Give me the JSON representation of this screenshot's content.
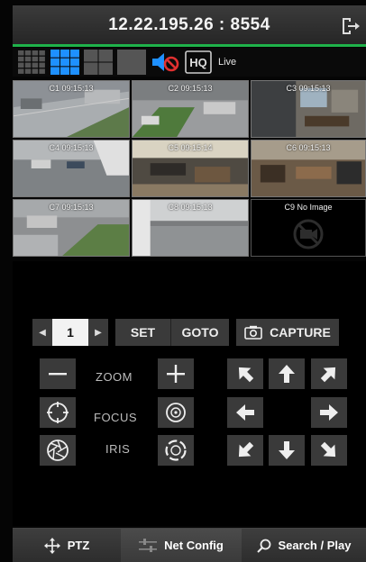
{
  "header": {
    "title": "12.22.195.26 : 8554",
    "logout_icon": "logout-icon"
  },
  "toolbar": {
    "layouts": [
      "layout-16-icon",
      "layout-9-icon",
      "layout-4-icon",
      "layout-1-icon"
    ],
    "active_layout": "layout-9-icon",
    "audio_icon": "audio-muted-icon",
    "hq_label": "HQ",
    "live_label": "Live"
  },
  "cameras": [
    {
      "label": "C1 09:15:13"
    },
    {
      "label": "C2 09:15:13"
    },
    {
      "label": "C3 09:15:13"
    },
    {
      "label": "C4 09:15:13"
    },
    {
      "label": "C5 09:15:14"
    },
    {
      "label": "C6 09:15:13"
    },
    {
      "label": "C7 09:15:13"
    },
    {
      "label": "C8 09:15:13"
    },
    {
      "label": "C9 No Image"
    }
  ],
  "preset": {
    "value": "1",
    "set_label": "SET",
    "goto_label": "GOTO",
    "capture_label": "CAPTURE"
  },
  "controls": {
    "zoom_label": "ZOOM",
    "focus_label": "FOCUS",
    "iris_label": "IRIS"
  },
  "tabs": {
    "ptz_label": "PTZ",
    "net_label": "Net Config",
    "search_label": "Search / Play"
  },
  "colors": {
    "accent_green": "#1fb24a",
    "active_blue": "#1e90ff"
  }
}
